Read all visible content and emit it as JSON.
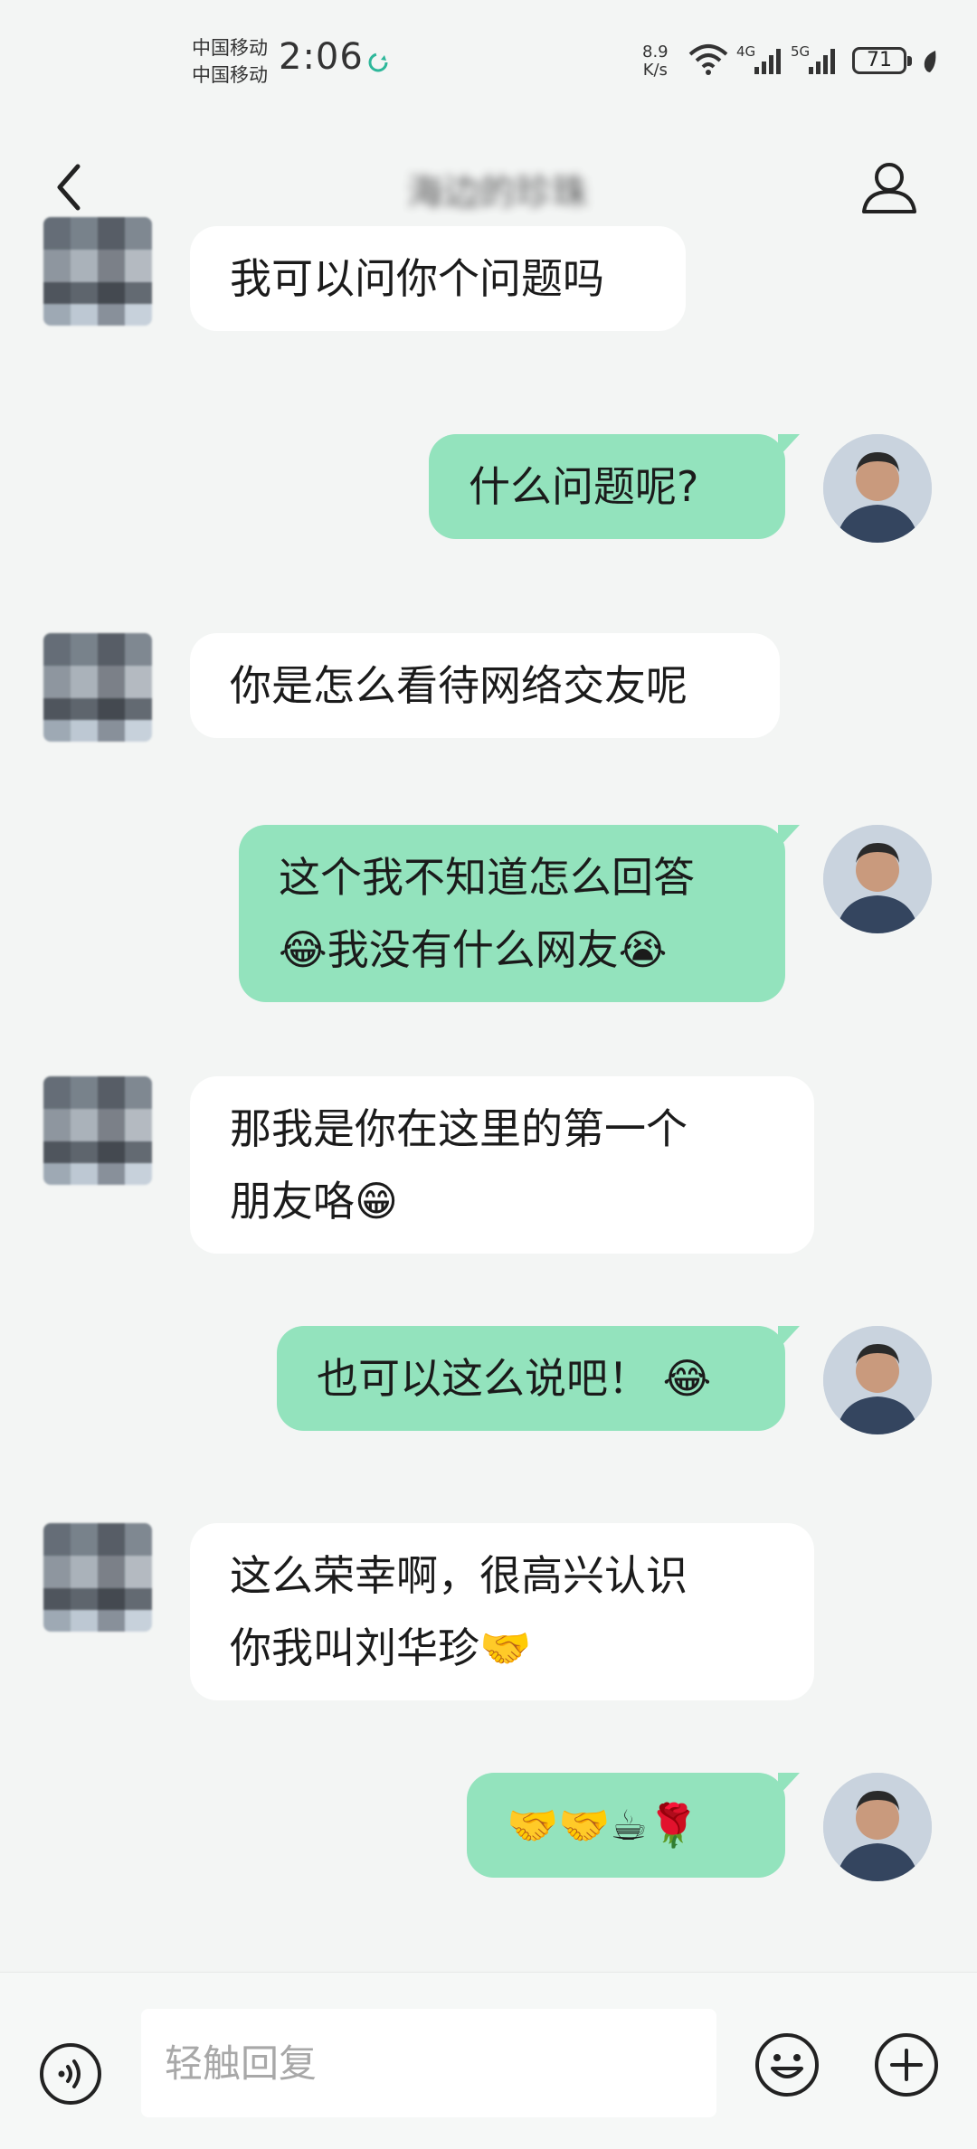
{
  "status_bar": {
    "carrier_1": "中国移动",
    "carrier_2": "中国移动",
    "time": "2:06",
    "speed_value": "8.9",
    "speed_unit": "K/s",
    "network_1": "4G",
    "network_2": "5G",
    "battery": "71"
  },
  "header": {
    "title": "海边的珍珠"
  },
  "messages": [
    {
      "from": "contact",
      "text": "我可以问你个问题吗"
    },
    {
      "from": "me",
      "text": "什么问题呢?"
    },
    {
      "from": "contact",
      "text": "你是怎么看待网络交友呢"
    },
    {
      "from": "me",
      "line1": "这个我不知道怎么回答",
      "line2": "😂我没有什么网友😭"
    },
    {
      "from": "contact",
      "line1": "那我是你在这里的第一个",
      "line2": "朋友咯😁"
    },
    {
      "from": "me",
      "text": "也可以这么说吧！ 😂"
    },
    {
      "from": "contact",
      "line1": "这么荣幸啊，很高兴认识",
      "line2": "你我叫刘华珍🤝"
    },
    {
      "from": "me",
      "text": "🤝🤝☕🌹"
    }
  ],
  "input": {
    "placeholder": "轻触回复"
  },
  "colors": {
    "outgoing_bubble": "#93e3bd",
    "incoming_bubble": "#ffffff",
    "background": "#f3f5f4"
  },
  "icons": [
    "back-arrow-icon",
    "person-icon",
    "voice-icon",
    "emoji-icon",
    "plus-icon",
    "wifi-icon",
    "signal-icon",
    "battery-icon",
    "sync-icon",
    "leaf-icon"
  ]
}
